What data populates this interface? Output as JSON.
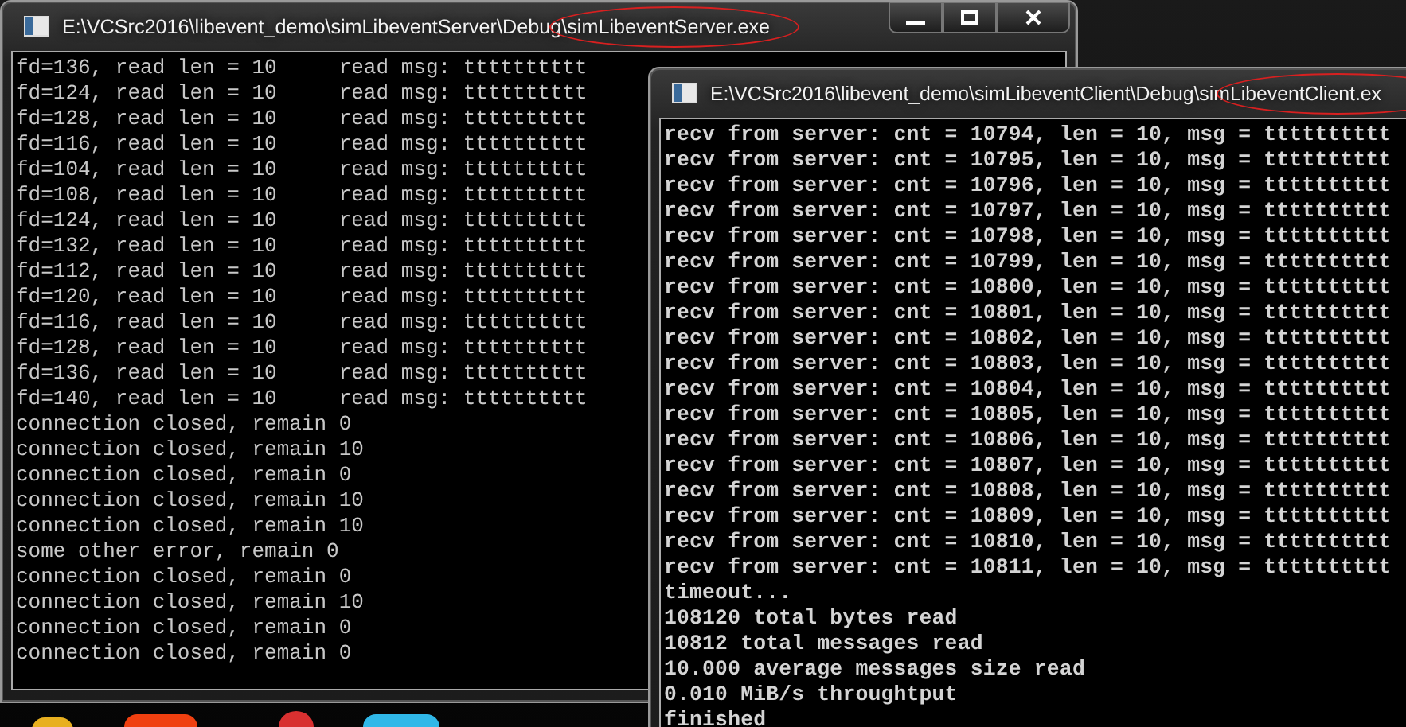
{
  "windows": [
    {
      "title": "E:\\VCSrc2016\\libevent_demo\\simLibeventServer\\Debug\\simLibeventServer.exe",
      "title_marked": true,
      "controls": true,
      "lines": [
        "fd=136, read len = 10     read msg: tttttttttt",
        "fd=124, read len = 10     read msg: tttttttttt",
        "fd=128, read len = 10     read msg: tttttttttt",
        "fd=116, read len = 10     read msg: tttttttttt",
        "fd=104, read len = 10     read msg: tttttttttt",
        "fd=108, read len = 10     read msg: tttttttttt",
        "fd=124, read len = 10     read msg: tttttttttt",
        "fd=132, read len = 10     read msg: tttttttttt",
        "fd=112, read len = 10     read msg: tttttttttt",
        "fd=120, read len = 10     read msg: tttttttttt",
        "fd=116, read len = 10     read msg: tttttttttt",
        "fd=128, read len = 10     read msg: tttttttttt",
        "fd=136, read len = 10     read msg: tttttttttt",
        "fd=140, read len = 10     read msg: tttttttttt",
        "connection closed, remain 0",
        "connection closed, remain 10",
        "connection closed, remain 0",
        "connection closed, remain 10",
        "connection closed, remain 10",
        "some other error, remain 0",
        "connection closed, remain 0",
        "connection closed, remain 10",
        "connection closed, remain 0",
        "connection closed, remain 0"
      ]
    },
    {
      "title": "E:\\VCSrc2016\\libevent_demo\\simLibeventClient\\Debug\\simLibeventClient.ex",
      "title_marked": true,
      "controls": false,
      "lines": [
        "recv from server: cnt = 10794, len = 10, msg = tttttttttt",
        "recv from server: cnt = 10795, len = 10, msg = tttttttttt",
        "recv from server: cnt = 10796, len = 10, msg = tttttttttt",
        "recv from server: cnt = 10797, len = 10, msg = tttttttttt",
        "recv from server: cnt = 10798, len = 10, msg = tttttttttt",
        "recv from server: cnt = 10799, len = 10, msg = tttttttttt",
        "recv from server: cnt = 10800, len = 10, msg = tttttttttt",
        "recv from server: cnt = 10801, len = 10, msg = tttttttttt",
        "recv from server: cnt = 10802, len = 10, msg = tttttttttt",
        "recv from server: cnt = 10803, len = 10, msg = tttttttttt",
        "recv from server: cnt = 10804, len = 10, msg = tttttttttt",
        "recv from server: cnt = 10805, len = 10, msg = tttttttttt",
        "recv from server: cnt = 10806, len = 10, msg = tttttttttt",
        "recv from server: cnt = 10807, len = 10, msg = tttttttttt",
        "recv from server: cnt = 10808, len = 10, msg = tttttttttt",
        "recv from server: cnt = 10809, len = 10, msg = tttttttttt",
        "recv from server: cnt = 10810, len = 10, msg = tttttttttt",
        "recv from server: cnt = 10811, len = 10, msg = tttttttttt",
        "timeout...",
        "108120 total bytes read",
        "10812 total messages read",
        "10.000 average messages size read",
        "0.010 MiB/s throughtput",
        "finished"
      ]
    }
  ]
}
